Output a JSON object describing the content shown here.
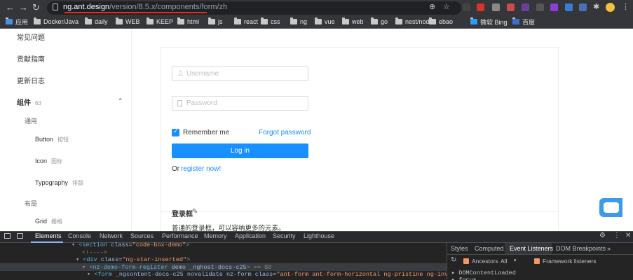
{
  "browser": {
    "url_domain": "ng.ant.design",
    "url_path": "/version/8.5.x/components/form/zh",
    "bookmarks": [
      "应用",
      "Docker/Java",
      "daily",
      "WEB",
      "KEEP",
      "html",
      "js",
      "react",
      "css",
      "ng",
      "vue",
      "web",
      "go",
      "nest/node",
      "ebao",
      "微软 Bing",
      "百度"
    ]
  },
  "sidebar": {
    "items": [
      {
        "label": "常见问题",
        "sub": ""
      },
      {
        "label": "贡献指南",
        "sub": ""
      },
      {
        "label": "更新日志",
        "sub": ""
      },
      {
        "label": "组件",
        "sub": "63"
      },
      {
        "label": "通用",
        "sub": ""
      },
      {
        "label": "Button",
        "sub": "按钮"
      },
      {
        "label": "Icon",
        "sub": "图标"
      },
      {
        "label": "Typography",
        "sub": "排版"
      },
      {
        "label": "布局",
        "sub": ""
      },
      {
        "label": "Grid",
        "sub": "栅格"
      }
    ]
  },
  "form": {
    "username_placeholder": "Username",
    "password_placeholder": "Password",
    "remember_label": "Remember me",
    "forgot_label": "Forgot password",
    "login_label": "Log in",
    "or_label": "Or",
    "register_label": "register now!",
    "demo_title": "登录框",
    "demo_desc": "普通的登录框，可以容纳更多的元素。"
  },
  "devtools": {
    "tabs": [
      "Elements",
      "Console",
      "Network",
      "Sources",
      "Performance",
      "Memory",
      "Application",
      "Security",
      "Lighthouse"
    ],
    "side_tabs": [
      "Styles",
      "Computed",
      "Event Listeners",
      "DOM Breakpoints"
    ],
    "ancestors_label": "Ancestors",
    "ancestors_value": "All",
    "framework_label": "Framework listeners",
    "event_item": "DOMContentLoaded",
    "event_item2": "focus",
    "code_lines": {
      "l1_tag": "<section",
      "l1_attr": " class=",
      "l1_val": "\"code-box-demo\"",
      "l1_end": ">",
      "l2": "<!---->",
      "l3_tag": "<div",
      "l3_attr": " class=",
      "l3_val": "\"ng-star-inserted\"",
      "l3_end": ">",
      "l4_tag": "<nz-demo-form-register",
      "l4_attr": " demo _nghost-docs-c25",
      "l4_end": "> == $0",
      "l5_tag": "<form",
      "l5_attr": " _ngcontent-docs-c25 novalidate nz-form class=",
      "l5_val": "\"ant-form ant-form-horizontal ng-pristine ng-invalid"
    }
  }
}
